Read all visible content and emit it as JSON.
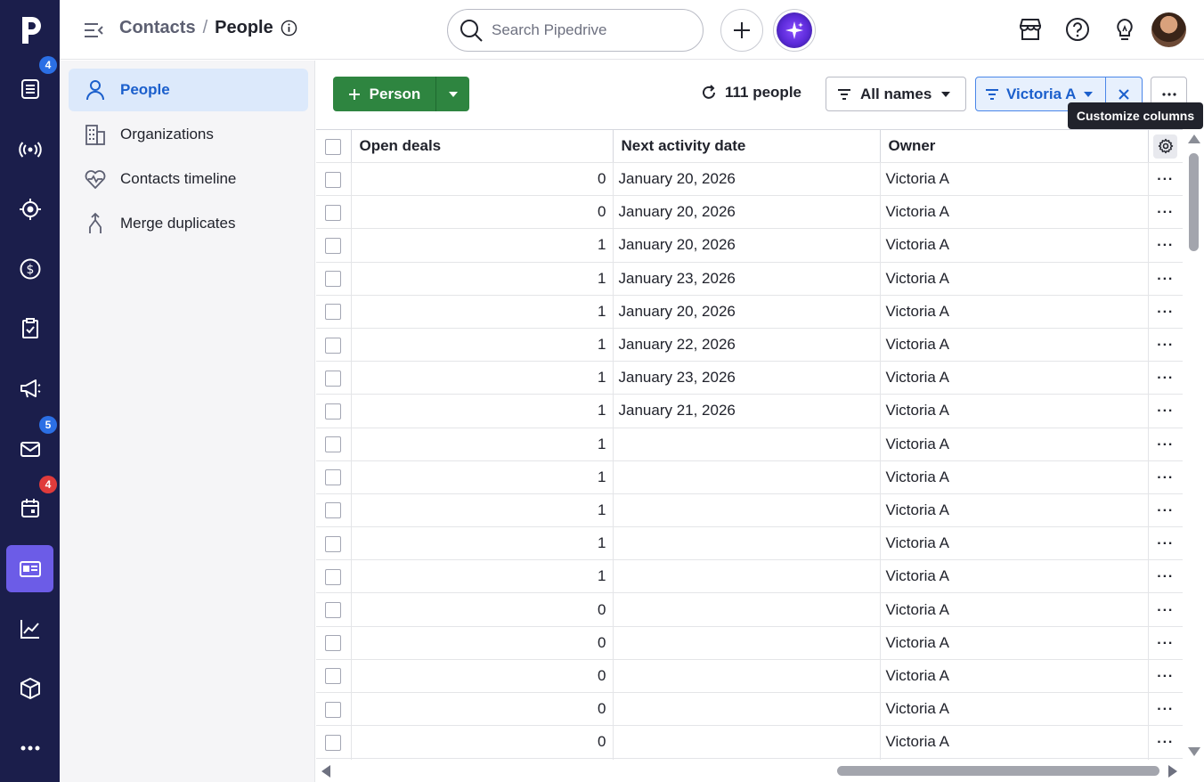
{
  "rail": {
    "items": [
      {
        "name": "leads",
        "icon": "leads-inbox-icon",
        "badge": "4",
        "badge_color": "#2b6fe5"
      },
      {
        "name": "live",
        "icon": "broadcast-icon",
        "badge": null
      },
      {
        "name": "goals",
        "icon": "target-icon",
        "badge": null
      },
      {
        "name": "deals",
        "icon": "dollar-icon",
        "badge": null
      },
      {
        "name": "activities",
        "icon": "clipboard-check-icon",
        "badge": null
      },
      {
        "name": "campaigns",
        "icon": "megaphone-icon",
        "badge": null
      },
      {
        "name": "mail",
        "icon": "mail-icon",
        "badge": "5",
        "badge_color": "#2b6fe5"
      },
      {
        "name": "calendar",
        "icon": "calendar-icon",
        "badge": "4",
        "badge_color": "#e03b3b"
      },
      {
        "name": "contacts",
        "icon": "contact-card-icon",
        "badge": null,
        "active": true
      },
      {
        "name": "insights",
        "icon": "chart-line-icon",
        "badge": null
      },
      {
        "name": "products",
        "icon": "box-icon",
        "badge": null
      },
      {
        "name": "more",
        "icon": "more-horizontal-icon",
        "badge": null
      }
    ]
  },
  "header": {
    "breadcrumb_parent": "Contacts",
    "breadcrumb_sep": "/",
    "breadcrumb_current": "People",
    "search_placeholder": "Search Pipedrive"
  },
  "sidebar": {
    "items": [
      {
        "label": "People",
        "icon": "person-icon",
        "active": true
      },
      {
        "label": "Organizations",
        "icon": "building-icon",
        "active": false
      },
      {
        "label": "Contacts timeline",
        "icon": "heart-pulse-icon",
        "active": false
      },
      {
        "label": "Merge duplicates",
        "icon": "merge-icon",
        "active": false
      }
    ]
  },
  "toolbar": {
    "add_person_label": "Person",
    "count_label": "111 people",
    "filter_names_label": "All names",
    "owner_filter_label": "Victoria A",
    "tooltip": "Customize columns"
  },
  "table": {
    "columns": [
      "Open deals",
      "Next activity date",
      "Owner"
    ],
    "rows": [
      {
        "deals": "0",
        "date": "January 20, 2026",
        "owner": "Victoria A"
      },
      {
        "deals": "0",
        "date": "January 20, 2026",
        "owner": "Victoria A"
      },
      {
        "deals": "1",
        "date": "January 20, 2026",
        "owner": "Victoria A"
      },
      {
        "deals": "1",
        "date": "January 23, 2026",
        "owner": "Victoria A"
      },
      {
        "deals": "1",
        "date": "January 20, 2026",
        "owner": "Victoria A"
      },
      {
        "deals": "1",
        "date": "January 22, 2026",
        "owner": "Victoria A"
      },
      {
        "deals": "1",
        "date": "January 23, 2026",
        "owner": "Victoria A"
      },
      {
        "deals": "1",
        "date": "January 21, 2026",
        "owner": "Victoria A"
      },
      {
        "deals": "1",
        "date": "",
        "owner": "Victoria A"
      },
      {
        "deals": "1",
        "date": "",
        "owner": "Victoria A"
      },
      {
        "deals": "1",
        "date": "",
        "owner": "Victoria A"
      },
      {
        "deals": "1",
        "date": "",
        "owner": "Victoria A"
      },
      {
        "deals": "1",
        "date": "",
        "owner": "Victoria A"
      },
      {
        "deals": "0",
        "date": "",
        "owner": "Victoria A"
      },
      {
        "deals": "0",
        "date": "",
        "owner": "Victoria A"
      },
      {
        "deals": "0",
        "date": "",
        "owner": "Victoria A"
      },
      {
        "deals": "0",
        "date": "",
        "owner": "Victoria A"
      },
      {
        "deals": "0",
        "date": "",
        "owner": "Victoria A"
      },
      {
        "deals": "",
        "date": "",
        "owner": ""
      }
    ]
  },
  "colors": {
    "rail_bg": "#1b1e4b",
    "rail_active": "#6c5ce7",
    "primary_green": "#2e8540",
    "accent_blue": "#1b5fcc",
    "sidebar_active_bg": "#dce9fb"
  }
}
